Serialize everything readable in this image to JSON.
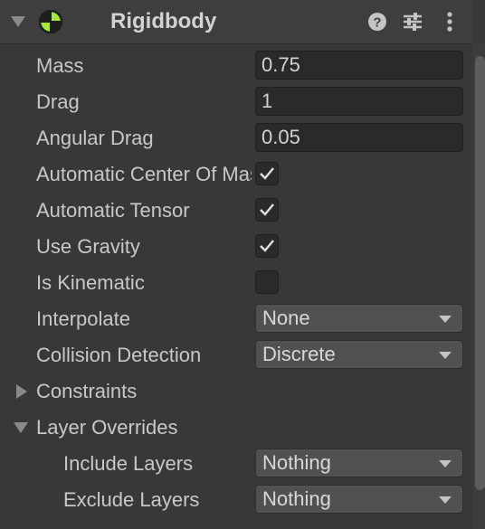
{
  "component": {
    "title": "Rigidbody",
    "colors": {
      "background": "#383838",
      "header_background": "#3e3e3e",
      "field_background": "#2a2a2a",
      "dropdown_background": "#515151",
      "icon_accent": "#a4e83a",
      "text": "#c8c8c8"
    }
  },
  "header": {
    "foldout_icon": "chevron-down-icon",
    "component_icon": "rigidbody-icon",
    "help_icon": "help-icon",
    "presets_icon": "presets-sliders-icon",
    "menu_icon": "kebab-menu-icon"
  },
  "fields": {
    "mass": {
      "label": "Mass",
      "value": "0.75"
    },
    "drag": {
      "label": "Drag",
      "value": "1"
    },
    "angular_drag": {
      "label": "Angular Drag",
      "value": "0.05"
    },
    "automatic_center_of_mass": {
      "label": "Automatic Center Of Mass",
      "checked": true
    },
    "automatic_tensor": {
      "label": "Automatic Tensor",
      "checked": true
    },
    "use_gravity": {
      "label": "Use Gravity",
      "checked": true
    },
    "is_kinematic": {
      "label": "Is Kinematic",
      "checked": false
    },
    "interpolate": {
      "label": "Interpolate",
      "value": "None"
    },
    "collision_detection": {
      "label": "Collision Detection",
      "value": "Discrete"
    }
  },
  "foldouts": {
    "constraints": {
      "label": "Constraints",
      "expanded": false
    },
    "layer_overrides": {
      "label": "Layer Overrides",
      "expanded": true
    }
  },
  "layer_overrides": {
    "include_layers": {
      "label": "Include Layers",
      "value": "Nothing"
    },
    "exclude_layers": {
      "label": "Exclude Layers",
      "value": "Nothing"
    }
  }
}
